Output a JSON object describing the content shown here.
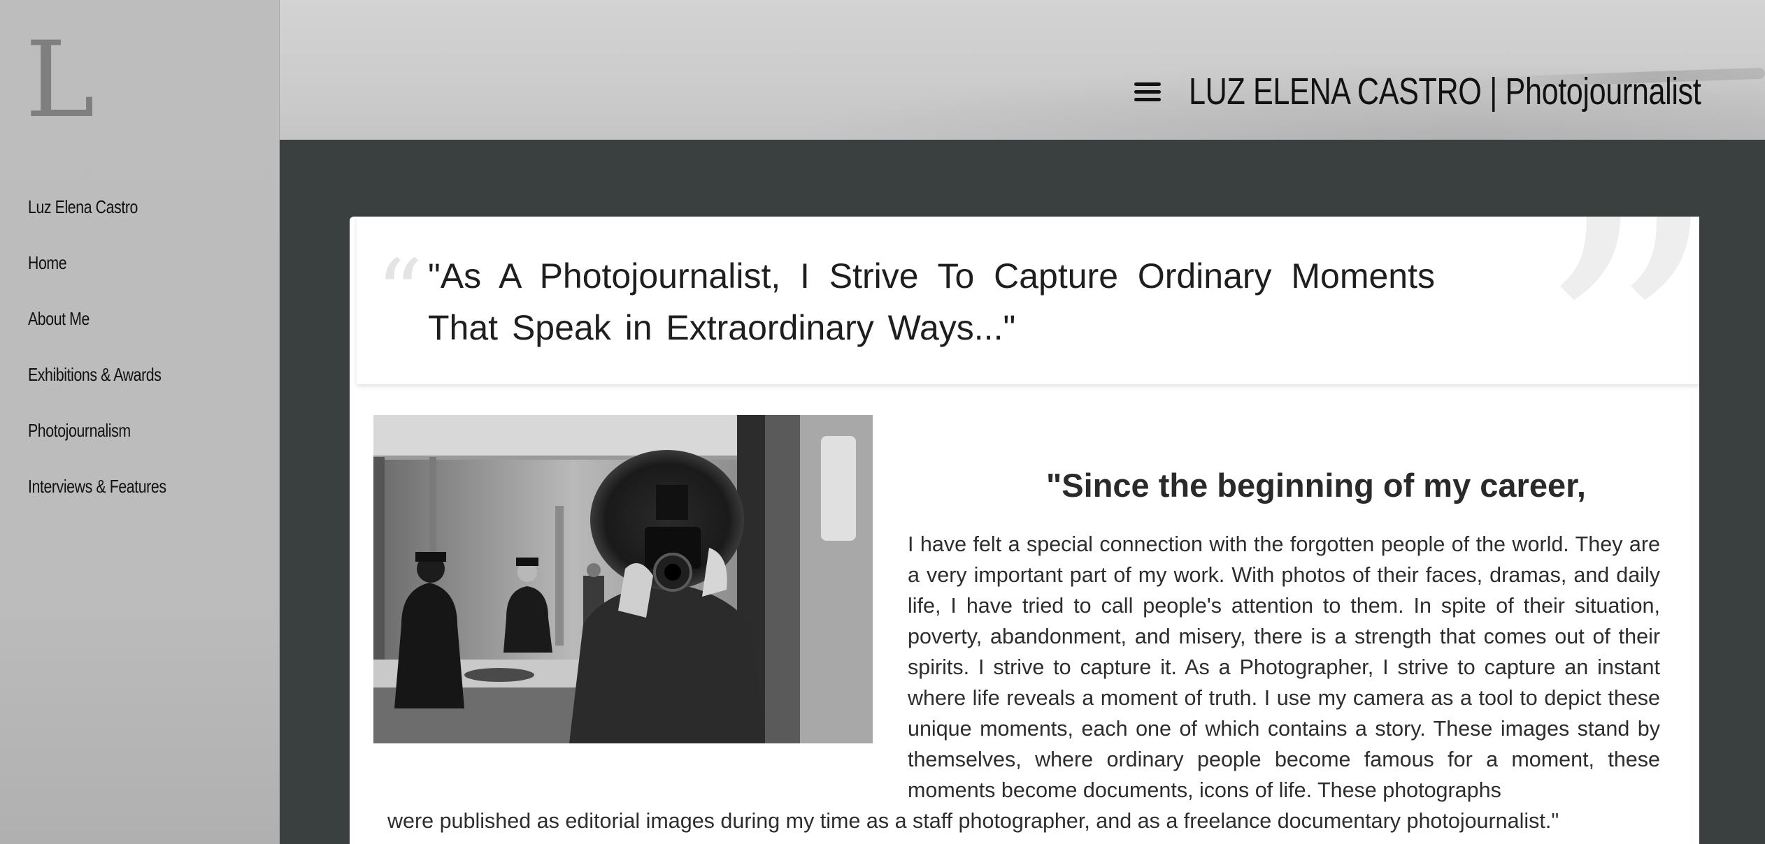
{
  "sidebar": {
    "logo_letter": "L",
    "items": [
      {
        "label": "Luz Elena Castro"
      },
      {
        "label": "Home"
      },
      {
        "label": "About Me"
      },
      {
        "label": "Exhibitions & Awards"
      },
      {
        "label": "Photojournalism"
      },
      {
        "label": "Interviews & Features"
      }
    ]
  },
  "header": {
    "menu_icon": "hamburger-menu-icon",
    "title": "LUZ ELENA CASTRO | Photojournalist"
  },
  "main": {
    "pullquote": {
      "open_mark": "“",
      "close_mark": "”",
      "text": "\"As A Photojournalist, I Strive To Capture Ordinary Moments That Speak in Extraordinary Ways...\""
    },
    "photo_description": "black-and-white photo of photographer taking a mirror self-portrait",
    "heading": "\"Since the beginning of my career,",
    "body": "I have felt a special connection with the forgotten people of the world. They are a very important part of my work. With photos of their faces, dramas, and daily life, I have tried to call people's attention to them. In spite of their situation, poverty, abandonment, and misery, there is a strength that comes out of their spirits. I strive to capture it. As a Photographer, I strive to capture an instant where life reveals a moment of truth. I use my camera as a tool to depict these unique moments, each one of which contains a story. These images stand by themselves, where ordinary people become famous for a moment, these moments become documents, icons of life. These photographs",
    "body_tail": "were published as editorial images during my time as a staff photographer, and as a freelance documentary photojournalist.\""
  },
  "colors": {
    "sidebar_bg": "#bdbdbd",
    "page_bg": "#3a3f3f",
    "card_bg": "#ffffff",
    "header_bg": "#cbcccb",
    "text": "#1e1e1e"
  }
}
